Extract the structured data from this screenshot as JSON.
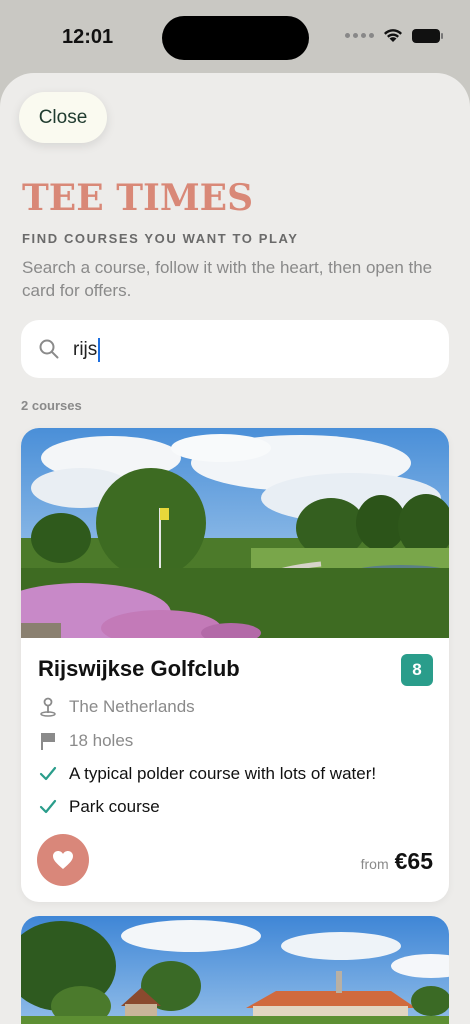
{
  "status_bar": {
    "time": "12:01"
  },
  "sheet": {
    "close_label": "Close",
    "title": "TEE TIMES",
    "subtitle": "FIND COURSES YOU WANT TO PLAY",
    "description": "Search a course, follow it with the heart, then open the card for offers.",
    "search": {
      "value": "rijs",
      "icon": "search-icon"
    },
    "result_count": "2 courses"
  },
  "courses": [
    {
      "name": "Rijswijkse Golfclub",
      "score": "8",
      "country": "The Netherlands",
      "holes": "18 holes",
      "features": [
        "A typical polder course with lots of water!",
        "Park course"
      ],
      "price_prefix": "from",
      "price": "€65",
      "favorited": true
    }
  ],
  "colors": {
    "accent": "#d98877",
    "badge": "#2a9d8b",
    "check": "#2a9d8b",
    "background": "#edecea"
  }
}
